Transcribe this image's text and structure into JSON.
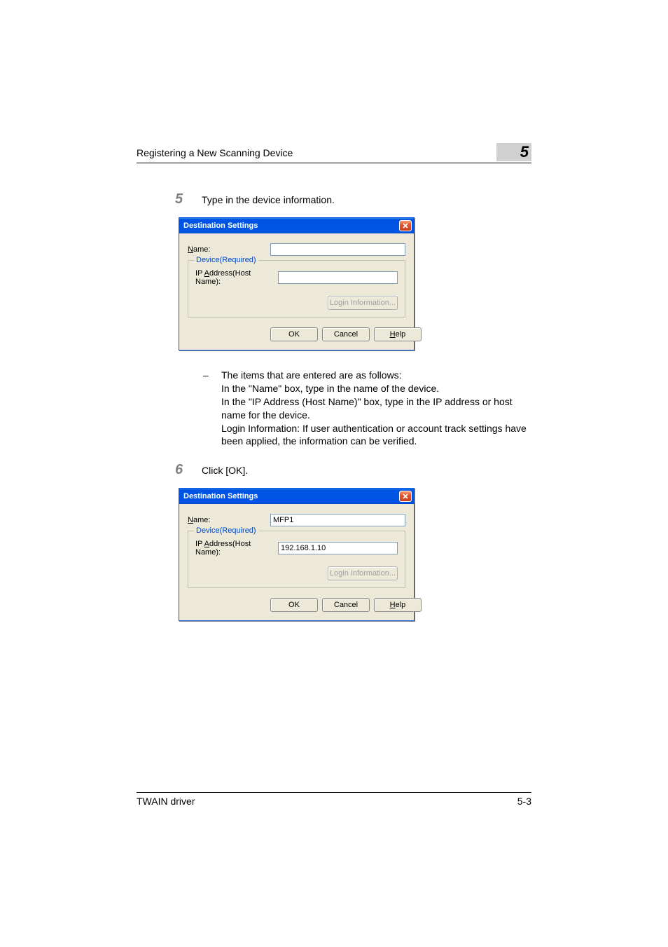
{
  "header": {
    "title": "Registering a New Scanning Device",
    "chapter_number": "5"
  },
  "steps": {
    "step5": {
      "number": "5",
      "text": "Type in the device information."
    },
    "step6": {
      "number": "6",
      "text": "Click [OK]."
    }
  },
  "dialog1": {
    "title": "Destination Settings",
    "name_label_pre": "N",
    "name_label_post": "ame:",
    "name_value": "",
    "fieldset_legend": "Device(Required)",
    "ip_label_pre": "IP ",
    "ip_label_underline": "A",
    "ip_label_post": "ddress(Host Name):",
    "ip_value": "",
    "login_btn": "Login Information...",
    "ok_btn": "OK",
    "cancel_btn": "Cancel",
    "help_btn_pre": "H",
    "help_btn_post": "elp"
  },
  "bullets": {
    "b1": "The items that are entered are as follows:",
    "s1": "In the \"Name\" box, type in the name of the device.",
    "s2": "In the \"IP Address (Host Name)\" box, type in the IP address or host name for the device.",
    "s3": "Login Information: If user authentication or account track settings have been applied, the information can be verified."
  },
  "dialog2": {
    "title": "Destination Settings",
    "name_label_pre": "N",
    "name_label_post": "ame:",
    "name_value": "MFP1",
    "fieldset_legend": "Device(Required)",
    "ip_label_pre": "IP ",
    "ip_label_underline": "A",
    "ip_label_post": "ddress(Host Name):",
    "ip_value": "192.168.1.10",
    "login_btn": "Login Information...",
    "ok_btn": "OK",
    "cancel_btn": "Cancel",
    "help_btn_pre": "H",
    "help_btn_post": "elp"
  },
  "footer": {
    "left": "TWAIN driver",
    "right": "5-3"
  }
}
